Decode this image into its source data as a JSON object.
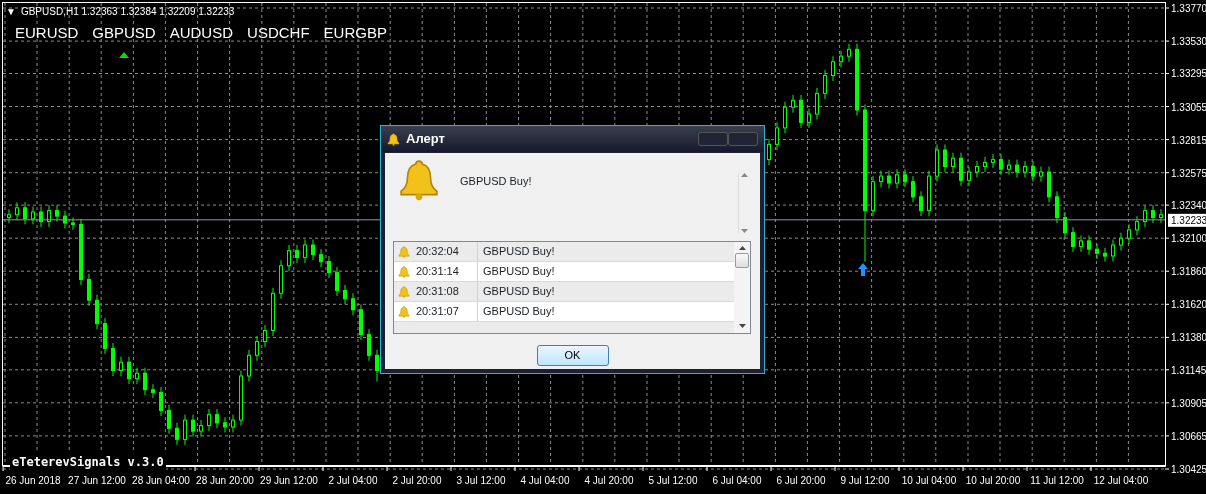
{
  "chart": {
    "header_marker": "▼",
    "header": "GBPUSD,H1  1.32363 1.32384 1.32209 1.32233",
    "symbols": [
      {
        "label": "EURUSD",
        "selected": false
      },
      {
        "label": "GBPUSD",
        "selected": true
      },
      {
        "label": "AUDUSD",
        "selected": false
      },
      {
        "label": "USDCHF",
        "selected": false
      },
      {
        "label": "EURGBP",
        "selected": false
      }
    ],
    "indicator_label": "eTeterevSignals v.3.0",
    "chart_data": {
      "type": "candlestick",
      "categories": [
        null,
        null,
        null,
        "26 Jun 2018",
        null,
        null,
        null,
        null,
        null,
        null,
        null,
        "27 Jun 12:00",
        null,
        null,
        null,
        null,
        null,
        null,
        null,
        "28 Jun 04:00",
        null,
        null,
        null,
        null,
        null,
        null,
        null,
        "28 Jun 20:00",
        null,
        null,
        null,
        null,
        null,
        null,
        null,
        "29 Jun 12:00",
        null,
        null,
        null,
        null,
        null,
        null,
        null,
        "2 Jul 04:00",
        null,
        null,
        null,
        null,
        null,
        null,
        null,
        "2 Jul 20:00",
        null,
        null,
        null,
        null,
        null,
        null,
        null,
        "3 Jul 12:00",
        null,
        null,
        null,
        null,
        null,
        null,
        null,
        "4 Jul 04:00",
        null,
        null,
        null,
        null,
        null,
        null,
        null,
        "4 Jul 20:00",
        null,
        null,
        null,
        null,
        null,
        null,
        null,
        "5 Jul 12:00",
        null,
        null,
        null,
        null,
        null,
        null,
        null,
        "6 Jul 04:00",
        null,
        null,
        null,
        null,
        null,
        null,
        null,
        "6 Jul 20:00",
        null,
        null,
        null,
        null,
        null,
        null,
        null,
        "9 Jul 12:00",
        null,
        null,
        null,
        null,
        null,
        null,
        null,
        "10 Jul 04:00",
        null,
        null,
        null,
        null,
        null,
        null,
        null,
        "10 Jul 20:00",
        null,
        null,
        null,
        null,
        null,
        null,
        null,
        "11 Jul 12:00",
        null,
        null,
        null,
        null,
        null,
        null,
        null,
        "12 Jul 04:00",
        null,
        null,
        null,
        null,
        null
      ],
      "grid": true,
      "ref_lines": [
        {
          "axis": "y",
          "value": 1.32233,
          "label": "1.32233"
        }
      ],
      "ohlc": [
        [
          1.3225,
          1.3231,
          1.3221,
          1.3227
        ],
        [
          1.3227,
          1.3236,
          1.3223,
          1.3232
        ],
        [
          1.3232,
          1.3236,
          1.322,
          1.3224
        ],
        [
          1.3224,
          1.3233,
          1.322,
          1.3229
        ],
        [
          1.3229,
          1.3233,
          1.3218,
          1.3222
        ],
        [
          1.3222,
          1.3234,
          1.3218,
          1.323
        ],
        [
          1.323,
          1.3234,
          1.3222,
          1.3226
        ],
        [
          1.3226,
          1.323,
          1.3217,
          1.3221
        ],
        [
          1.3221,
          1.3225,
          1.3216,
          1.322
        ],
        [
          1.322,
          1.3224,
          1.3176,
          1.318
        ],
        [
          1.318,
          1.3184,
          1.3161,
          1.3165
        ],
        [
          1.3165,
          1.3169,
          1.3144,
          1.3148
        ],
        [
          1.3148,
          1.3152,
          1.3126,
          1.313
        ],
        [
          1.313,
          1.3134,
          1.311,
          1.3114
        ],
        [
          1.3114,
          1.3124,
          1.311,
          1.312
        ],
        [
          1.312,
          1.3124,
          1.3104,
          1.3108
        ],
        [
          1.3108,
          1.3116,
          1.3104,
          1.3112
        ],
        [
          1.3112,
          1.3116,
          1.3096,
          1.31
        ],
        [
          1.31,
          1.3104,
          1.3094,
          1.3098
        ],
        [
          1.3098,
          1.3102,
          1.3081,
          1.3085
        ],
        [
          1.3085,
          1.3089,
          1.3068,
          1.3072
        ],
        [
          1.3072,
          1.3076,
          1.306,
          1.3064
        ],
        [
          1.3064,
          1.3082,
          1.306,
          1.3078
        ],
        [
          1.3078,
          1.3082,
          1.3066,
          1.307
        ],
        [
          1.307,
          1.3078,
          1.3066,
          1.3074
        ],
        [
          1.3074,
          1.3086,
          1.307,
          1.3082
        ],
        [
          1.3082,
          1.3086,
          1.3072,
          1.3076
        ],
        [
          1.3076,
          1.308,
          1.3069,
          1.3073
        ],
        [
          1.3073,
          1.3082,
          1.3069,
          1.3078
        ],
        [
          1.3078,
          1.3114,
          1.3074,
          1.311
        ],
        [
          1.311,
          1.3129,
          1.3106,
          1.3125
        ],
        [
          1.3125,
          1.3139,
          1.3121,
          1.3135
        ],
        [
          1.3135,
          1.3147,
          1.3131,
          1.3143
        ],
        [
          1.3143,
          1.3174,
          1.3139,
          1.317
        ],
        [
          1.317,
          1.3194,
          1.3166,
          1.319
        ],
        [
          1.319,
          1.3205,
          1.3186,
          1.3201
        ],
        [
          1.3201,
          1.3205,
          1.3192,
          1.3196
        ],
        [
          1.3196,
          1.3209,
          1.3192,
          1.3205
        ],
        [
          1.3205,
          1.3209,
          1.3194,
          1.3198
        ],
        [
          1.3198,
          1.3202,
          1.3189,
          1.3193
        ],
        [
          1.3193,
          1.3197,
          1.3181,
          1.3185
        ],
        [
          1.3185,
          1.3189,
          1.3168,
          1.3172
        ],
        [
          1.3172,
          1.3176,
          1.3162,
          1.3166
        ],
        [
          1.3166,
          1.317,
          1.3154,
          1.3158
        ],
        [
          1.3158,
          1.3162,
          1.3136,
          1.314
        ],
        [
          1.314,
          1.3144,
          1.3121,
          1.3125
        ],
        [
          1.3125,
          1.3129,
          1.3106,
          1.3114
        ],
        null,
        null,
        null,
        null,
        null,
        null,
        null,
        null,
        null,
        null,
        null,
        null,
        null,
        null,
        null,
        null,
        null,
        null,
        null,
        null,
        null,
        null,
        null,
        null,
        null,
        null,
        null,
        null,
        null,
        null,
        null,
        null,
        null,
        null,
        null,
        null,
        null,
        null,
        null,
        null,
        null,
        null,
        null,
        null,
        null,
        null,
        null,
        null,
        [
          1.3267,
          1.3282,
          1.3263,
          1.3278
        ],
        [
          1.3278,
          1.3294,
          1.3274,
          1.329
        ],
        [
          1.329,
          1.3309,
          1.3286,
          1.3305
        ],
        [
          1.3305,
          1.3314,
          1.3301,
          1.331
        ],
        [
          1.331,
          1.3314,
          1.329,
          1.3294
        ],
        [
          1.3294,
          1.3304,
          1.329,
          1.33
        ],
        [
          1.33,
          1.3319,
          1.3296,
          1.3315
        ],
        [
          1.3315,
          1.3332,
          1.3311,
          1.3328
        ],
        [
          1.3328,
          1.3342,
          1.3324,
          1.3338
        ],
        [
          1.3338,
          1.3346,
          1.3334,
          1.3342
        ],
        [
          1.3342,
          1.3351,
          1.3338,
          1.3347
        ],
        [
          1.3347,
          1.3351,
          1.3299,
          1.3303
        ],
        [
          1.3303,
          1.3307,
          1.3193,
          1.323
        ],
        [
          1.323,
          1.3255,
          1.3226,
          1.3251
        ],
        [
          1.3251,
          1.3259,
          1.3247,
          1.3255
        ],
        [
          1.3255,
          1.3259,
          1.3246,
          1.325
        ],
        [
          1.325,
          1.326,
          1.3246,
          1.3256
        ],
        [
          1.3256,
          1.326,
          1.3247,
          1.3251
        ],
        [
          1.3251,
          1.3255,
          1.3236,
          1.324
        ],
        [
          1.324,
          1.3244,
          1.3226,
          1.323
        ],
        [
          1.323,
          1.3259,
          1.3226,
          1.3255
        ],
        [
          1.3255,
          1.3278,
          1.3251,
          1.3274
        ],
        [
          1.3274,
          1.3278,
          1.3258,
          1.3262
        ],
        [
          1.3262,
          1.3272,
          1.3258,
          1.3268
        ],
        [
          1.3268,
          1.3272,
          1.3248,
          1.3252
        ],
        [
          1.3252,
          1.3262,
          1.3248,
          1.3258
        ],
        [
          1.3258,
          1.3266,
          1.3254,
          1.3262
        ],
        [
          1.3262,
          1.3269,
          1.3258,
          1.3265
        ],
        [
          1.3265,
          1.3271,
          1.3261,
          1.3267
        ],
        [
          1.3267,
          1.3271,
          1.3256,
          1.326
        ],
        [
          1.326,
          1.3267,
          1.3256,
          1.3263
        ],
        [
          1.3263,
          1.3267,
          1.3254,
          1.3258
        ],
        [
          1.3258,
          1.3266,
          1.3254,
          1.3262
        ],
        [
          1.3262,
          1.3266,
          1.3251,
          1.3255
        ],
        [
          1.3255,
          1.3262,
          1.3251,
          1.3258
        ],
        [
          1.3258,
          1.3262,
          1.3236,
          1.324
        ],
        [
          1.324,
          1.3244,
          1.3221,
          1.3225
        ],
        [
          1.3225,
          1.3229,
          1.321,
          1.3214
        ],
        [
          1.3214,
          1.3218,
          1.32,
          1.3204
        ],
        [
          1.3204,
          1.3212,
          1.32,
          1.3208
        ],
        [
          1.3208,
          1.3212,
          1.3198,
          1.3202
        ],
        [
          1.3202,
          1.3206,
          1.3195,
          1.3199
        ],
        [
          1.3199,
          1.3203,
          1.3193,
          1.3197
        ],
        [
          1.3197,
          1.3209,
          1.3193,
          1.3205
        ],
        [
          1.3205,
          1.3214,
          1.3201,
          1.321
        ],
        [
          1.321,
          1.322,
          1.3206,
          1.3216
        ],
        [
          1.3216,
          1.3226,
          1.3212,
          1.3222
        ],
        [
          1.3222,
          1.3234,
          1.3218,
          1.323
        ],
        [
          1.323,
          1.3234,
          1.3221,
          1.3225
        ],
        [
          1.3225,
          1.3231,
          1.3221,
          1.3227
        ]
      ],
      "ylim": [
        1.30425,
        1.3377
      ],
      "yticks": [
        {
          "value": 1.3377,
          "label": "1.33770"
        },
        {
          "value": 1.3353,
          "label": "1.33530"
        },
        {
          "value": 1.33295,
          "label": "1.33295"
        },
        {
          "value": 1.33055,
          "label": "1.33055"
        },
        {
          "value": 1.32815,
          "label": "1.32815"
        },
        {
          "value": 1.32575,
          "label": "1.32575"
        },
        {
          "value": 1.3234,
          "label": "1.32340"
        },
        {
          "value": 1.321,
          "label": "1.32100"
        },
        {
          "value": 1.3186,
          "label": "1.31860"
        },
        {
          "value": 1.3162,
          "label": "1.31620"
        },
        {
          "value": 1.3138,
          "label": "1.31380"
        },
        {
          "value": 1.31145,
          "label": "1.31145"
        },
        {
          "value": 1.30905,
          "label": "1.30905"
        },
        {
          "value": 1.30665,
          "label": "1.30665"
        },
        {
          "value": 1.30425,
          "label": "1.30425"
        }
      ]
    }
  },
  "alert": {
    "title": "Алерт",
    "message": "GBPUSD Buy!",
    "log": [
      {
        "time": "20:32:04",
        "message": "GBPUSD Buy!"
      },
      {
        "time": "20:31:14",
        "message": "GBPUSD Buy!"
      },
      {
        "time": "20:31:08",
        "message": "GBPUSD Buy!"
      },
      {
        "time": "20:31:07",
        "message": "GBPUSD Buy!"
      }
    ],
    "ok_button": "OK"
  }
}
